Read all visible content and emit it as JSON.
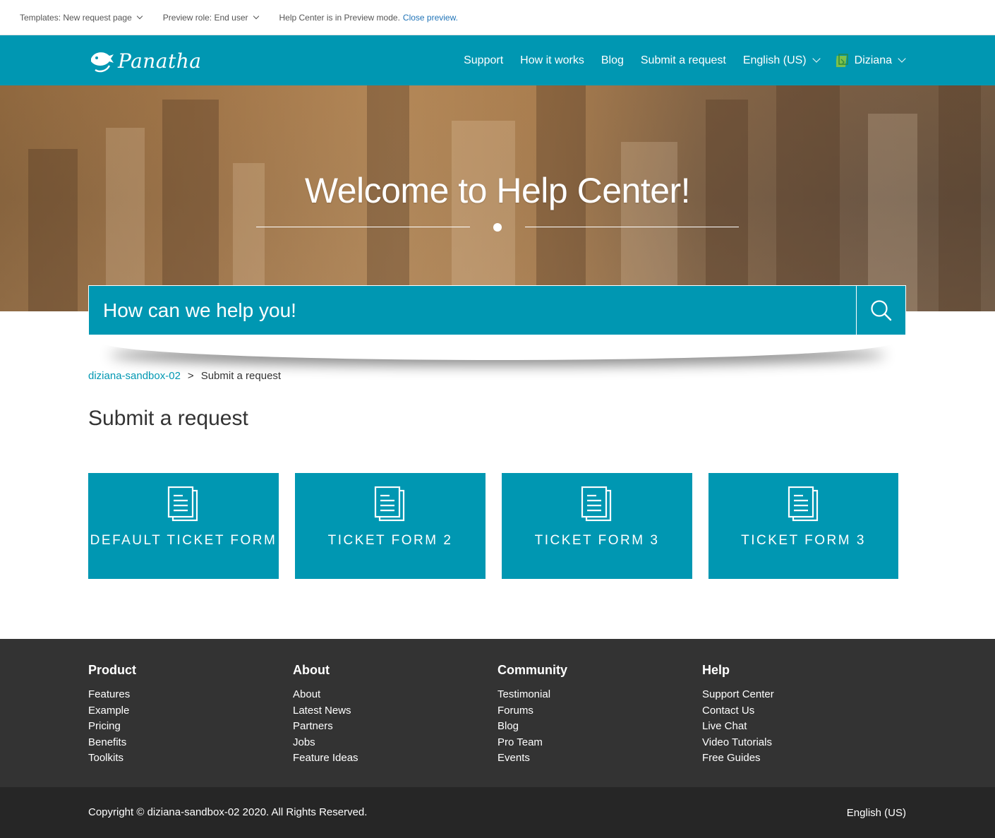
{
  "preview_bar": {
    "template_label": "Templates: New request page",
    "role_label": "Preview role: End user",
    "mode_text": "Help Center is in Preview mode.",
    "close_link": "Close preview."
  },
  "header": {
    "logo_text": "Panatha",
    "nav": [
      "Support",
      "How it works",
      "Blog",
      "Submit a request"
    ],
    "language": "English (US)",
    "user": "Diziana"
  },
  "hero": {
    "title": "Welcome to Help Center!"
  },
  "search": {
    "placeholder": "How can we help you!"
  },
  "breadcrumb": {
    "home": "diziana-sandbox-02",
    "separator": ">",
    "current": "Submit a request"
  },
  "page_title": "Submit a request",
  "forms": [
    {
      "label": "Default Ticket Form"
    },
    {
      "label": "Ticket Form 2"
    },
    {
      "label": "Ticket Form 3"
    },
    {
      "label": "Ticket Form 3"
    }
  ],
  "footer": {
    "columns": [
      {
        "title": "Product",
        "links": [
          "Features",
          "Example",
          "Pricing",
          "Benefits",
          "Toolkits"
        ]
      },
      {
        "title": "About",
        "links": [
          "About",
          "Latest News",
          "Partners",
          "Jobs",
          "Feature Ideas"
        ]
      },
      {
        "title": "Community",
        "links": [
          "Testimonial",
          "Forums",
          "Blog",
          "Pro Team",
          "Events"
        ]
      },
      {
        "title": "Help",
        "links": [
          "Support Center",
          "Contact Us",
          "Live Chat",
          "Video Tutorials",
          "Free Guides"
        ]
      }
    ],
    "copyright": "Copyright © diziana-sandbox-02 2020. All Rights Reserved.",
    "language": "English (US)"
  },
  "colors": {
    "brand": "#0097b2",
    "footer_bg": "#333333",
    "bottom_bar_bg": "#262626",
    "link": "#1f73b7"
  },
  "icons": {
    "search": "search-icon",
    "form": "document-icon",
    "chevron": "chevron-down-icon"
  }
}
